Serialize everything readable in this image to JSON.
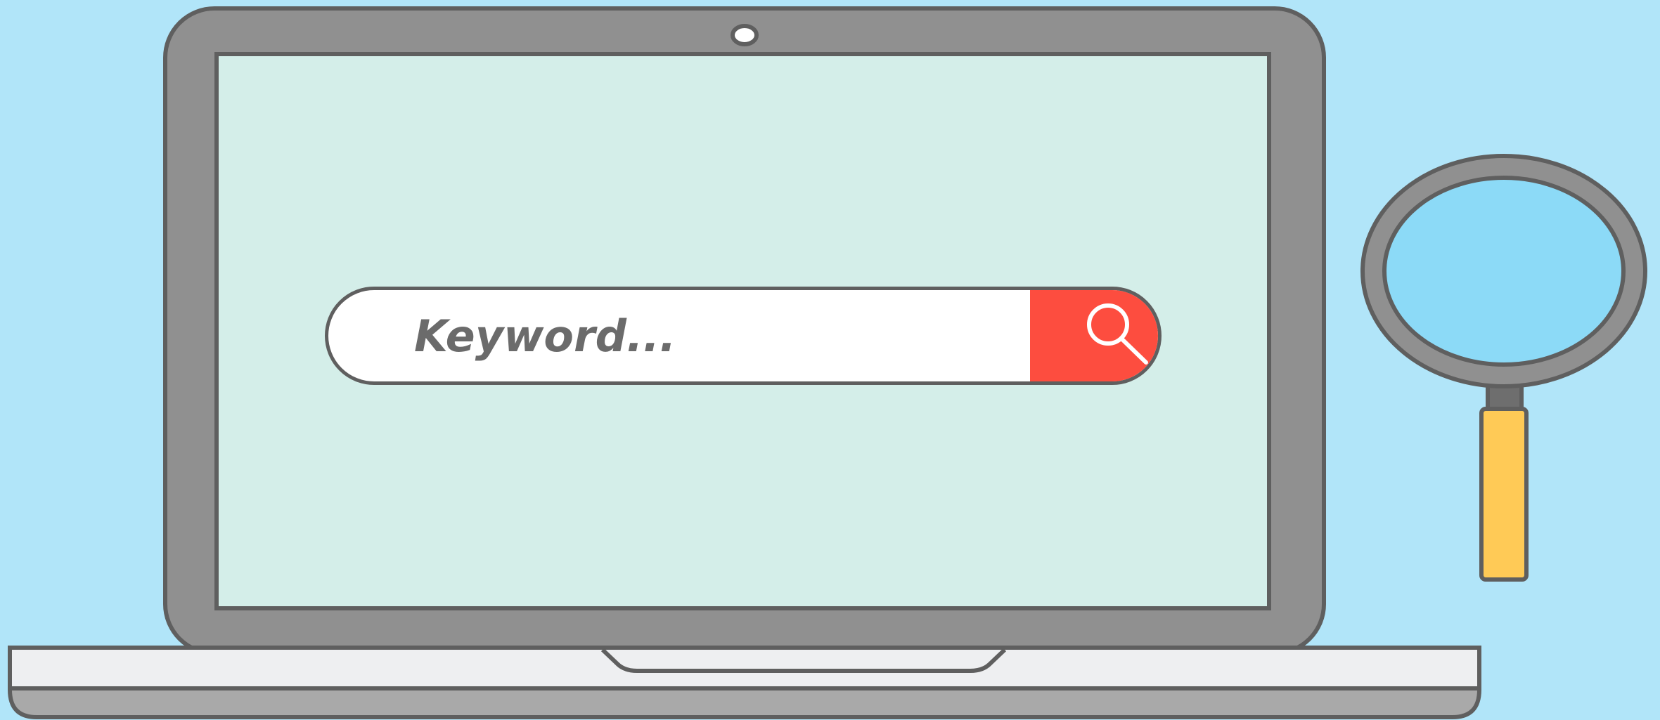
{
  "search": {
    "placeholder": "Keyword...",
    "button_icon": "search-icon"
  },
  "colors": {
    "background": "#b1e5f9",
    "laptop_body": "#909090",
    "laptop_outline": "#5f5f5f",
    "screen": "#d4eee9",
    "laptop_base": "#eeeff1",
    "search_button": "#fd4d3f",
    "magnifier_lens": "#8cdaf7",
    "magnifier_handle": "#ffca56"
  }
}
